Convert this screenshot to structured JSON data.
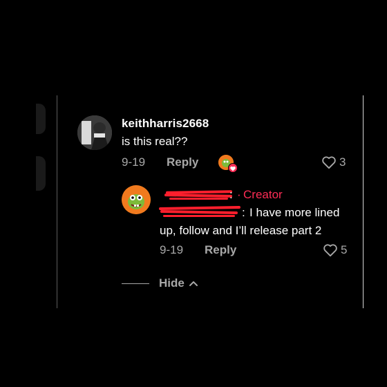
{
  "comment": {
    "username": "keithharris2668",
    "text": "is this real??",
    "date": "9-19",
    "reply_label": "Reply",
    "like_count": "3"
  },
  "reply": {
    "separator": ":",
    "dot": "·",
    "badge": "Creator",
    "colon": ":",
    "text_line1": "I have more lined",
    "text_line2": "up, follow and I’ll release part 2",
    "date": "9-19",
    "reply_label": "Reply",
    "like_count": "5"
  },
  "thread": {
    "hide_label": "Hide"
  },
  "colors": {
    "background": "#000000",
    "creator_accent": "#fe2c55",
    "meta_gray": "#a8a8a8",
    "redaction_red": "#ff1f2d"
  },
  "icons": {
    "like": "heart-outline-icon",
    "collapse": "chevron-up-icon",
    "liked_by_creator": "creator-liked-badge-icon"
  }
}
